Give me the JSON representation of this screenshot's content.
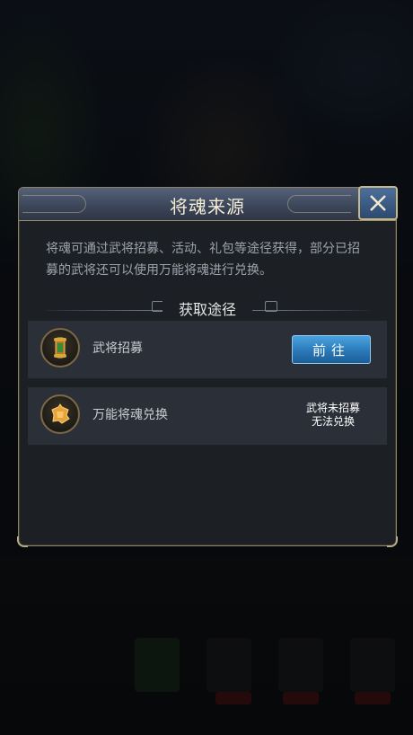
{
  "dialog": {
    "title": "将魂来源",
    "description": "将魂可通过武将招募、活动、礼包等途径获得，部分已招募的武将还可以使用万能将魂进行兑换。",
    "section_title": "获取途径",
    "rows": [
      {
        "label": "武将招募",
        "action_label": "前往",
        "icon": "scroll-icon"
      },
      {
        "label": "万能将魂兑换",
        "status_line1": "武将未招募",
        "status_line2": "无法兑换",
        "icon": "soul-puzzle-icon"
      }
    ]
  },
  "colors": {
    "accent_button": "#2a79b8",
    "frame_gold": "#b9ab83",
    "title_bar": "#3d475a"
  }
}
